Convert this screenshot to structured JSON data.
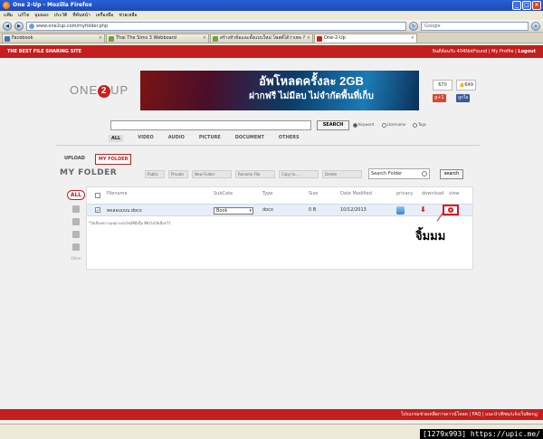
{
  "window": {
    "title": "One 2-Up - Mozilla Firefox",
    "controls": [
      "_",
      "□",
      "×"
    ]
  },
  "menu": [
    "แฟ้ม",
    "แก้ไข",
    "มุมมอง",
    "ประวัติ",
    "ที่คั่นหน้า",
    "เครื่องมือ",
    "ช่วยเหลือ"
  ],
  "nav": {
    "url": "www.one2up.com/myfolder.php",
    "search_placeholder": "Google"
  },
  "tabs": [
    {
      "label": "Facebook",
      "active": false
    },
    {
      "label": "Thai The Sims 3 Webboard",
      "active": false
    },
    {
      "label": "สร้างหัวข้อและตั้งแบบใหม่ โพสต์ได้ว่าเพจ ?",
      "active": false
    },
    {
      "label": "One-2-Up",
      "active": true
    }
  ],
  "site": {
    "tagline": "THE BEST FILE SHARING SITE",
    "welcome": "ยินดีต้อนรับ 404NotFound",
    "my_profile": "My Profile",
    "logout": "Logout",
    "logo_left": "ONE",
    "logo_mid": "2",
    "logo_right": "UP",
    "banner_line1": "อัพโหลดครั้งละ 2GB",
    "banner_line2": "ฝากฟรี ไม่มีลบ ไม่จำกัดพื้นที่เก็บ",
    "count_left": "670",
    "count_right": "649",
    "gplus": "g+1",
    "fb_like": "ถูกใจ"
  },
  "search": {
    "button": "SEARCH",
    "options": [
      {
        "label": "Keyword",
        "selected": true
      },
      {
        "label": "Username",
        "selected": false
      },
      {
        "label": "Tags",
        "selected": false
      }
    ],
    "categories": [
      {
        "label": "ALL",
        "active": true
      },
      {
        "label": "VIDEO",
        "active": false
      },
      {
        "label": "AUDIO",
        "active": false
      },
      {
        "label": "PICTURE",
        "active": false
      },
      {
        "label": "DOCUMENT",
        "active": false
      },
      {
        "label": "OTHERS",
        "active": false
      }
    ]
  },
  "subtabs": [
    {
      "label": "UPLOAD",
      "active": false
    },
    {
      "label": "MY FOLDER",
      "active": true
    }
  ],
  "folder": {
    "title": "MY FOLDER",
    "toolbar": [
      "Public",
      "Private",
      "New Folder",
      "Rename File",
      "Copy to.....",
      "Delete"
    ],
    "search_value": "Search Folder",
    "search_button": "search",
    "filters": {
      "all": "ALL",
      "other": "Other"
    },
    "columns": [
      "Filename",
      "SubCate",
      "Type",
      "Size",
      "Date Modified",
      "privacy",
      "download",
      "view"
    ],
    "rows": [
      {
        "checked": true,
        "filename": "ทดสอบบบบ.docx",
        "subcate": "Book",
        "type": "docx",
        "size": "0 B",
        "date": "10/12/2013"
      }
    ],
    "note": "*ใส่เลือกความเหมาะสมไฟล์ที่มีเนื้อ ที่ยังไม่ได้เลือกไว้"
  },
  "annotation": "จิ้มมม",
  "footer": "โปรแกรมช่วยเหลือการดาวน์โหลด | FAQ | แนะนำ/ติชม/แจ้งเว็บผิดกฎ",
  "watermark": "[1279x993] https://upic.me/"
}
